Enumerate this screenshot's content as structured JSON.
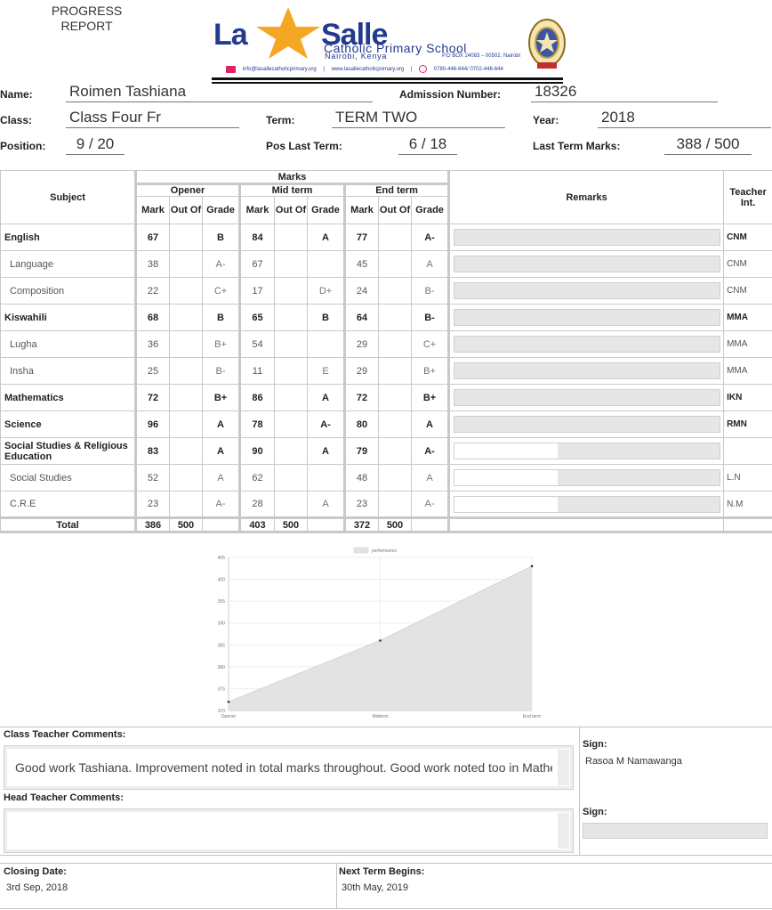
{
  "header": {
    "progress_line1": "PROGRESS",
    "progress_line2": "REPORT",
    "logo": {
      "word1": "La",
      "word2": "Salle",
      "school": "Catholic Primary School",
      "city": "Nairobi, Kenya",
      "po_box": "P.O BOX 24083 – 00502, Nairobi",
      "email": "info@lasallecatholicprimary.org",
      "website": "www.lasallecatholicprimary.org",
      "phone": "0780-446-644/ 0702-446-644",
      "colors": {
        "blue": "#233a8f",
        "star": "#f5a623"
      }
    }
  },
  "student": {
    "name_label": "Name:",
    "name": "Roimen Tashiana",
    "admission_label": "Admission Number:",
    "admission": "18326",
    "class_label": "Class:",
    "class": "Class Four Fr",
    "term_label": "Term:",
    "term": "TERM TWO",
    "year_label": "Year:",
    "year": "2018",
    "position_label": "Position:",
    "position": "9 / 20",
    "pos_last_label": "Pos Last Term:",
    "pos_last": "6 / 18",
    "last_marks_label": "Last Term Marks:",
    "last_marks": "388 / 500"
  },
  "table": {
    "headers": {
      "subject": "Subject",
      "marks": "Marks",
      "remarks": "Remarks",
      "teacher": "Teacher Int.",
      "opener": "Opener",
      "midterm": "Mid term",
      "endterm": "End term",
      "mark": "Mark",
      "outof": "Out Of",
      "grade": "Grade"
    },
    "rows": [
      {
        "name": "English",
        "level": "main",
        "op": [
          "67",
          "",
          "B"
        ],
        "mid": [
          "84",
          "",
          "A"
        ],
        "end": [
          "77",
          "",
          "A-"
        ],
        "remark": "",
        "remark_style": "full",
        "teacher": "CNM"
      },
      {
        "name": "Language",
        "level": "sub",
        "op": [
          "38",
          "",
          "A-"
        ],
        "mid": [
          "67",
          "",
          ""
        ],
        "end": [
          "45",
          "",
          "A"
        ],
        "remark": "",
        "remark_style": "full",
        "teacher": "CNM"
      },
      {
        "name": "Composition",
        "level": "sub",
        "op": [
          "22",
          "",
          "C+"
        ],
        "mid": [
          "17",
          "",
          "D+"
        ],
        "end": [
          "24",
          "",
          "B-"
        ],
        "remark": "",
        "remark_style": "full",
        "teacher": "CNM"
      },
      {
        "name": "Kiswahili",
        "level": "main",
        "op": [
          "68",
          "",
          "B"
        ],
        "mid": [
          "65",
          "",
          "B"
        ],
        "end": [
          "64",
          "",
          "B-"
        ],
        "remark": "",
        "remark_style": "full",
        "teacher": "MMA"
      },
      {
        "name": "Lugha",
        "level": "sub",
        "op": [
          "36",
          "",
          "B+"
        ],
        "mid": [
          "54",
          "",
          ""
        ],
        "end": [
          "29",
          "",
          "C+"
        ],
        "remark": "",
        "remark_style": "full",
        "teacher": "MMA"
      },
      {
        "name": "Insha",
        "level": "sub",
        "op": [
          "25",
          "",
          "B-"
        ],
        "mid": [
          "11",
          "",
          "E"
        ],
        "end": [
          "29",
          "",
          "B+"
        ],
        "remark": "",
        "remark_style": "full",
        "teacher": "MMA"
      },
      {
        "name": "Mathematics",
        "level": "main",
        "op": [
          "72",
          "",
          "B+"
        ],
        "mid": [
          "86",
          "",
          "A"
        ],
        "end": [
          "72",
          "",
          "B+"
        ],
        "remark": "",
        "remark_style": "full",
        "teacher": "IKN"
      },
      {
        "name": "Science",
        "level": "main",
        "op": [
          "96",
          "",
          "A"
        ],
        "mid": [
          "78",
          "",
          "A-"
        ],
        "end": [
          "80",
          "",
          "A"
        ],
        "remark": "",
        "remark_style": "full",
        "teacher": "RMN"
      },
      {
        "name": "Social Studies & Religious Education",
        "level": "main",
        "op": [
          "83",
          "",
          "A"
        ],
        "mid": [
          "90",
          "",
          "A"
        ],
        "end": [
          "79",
          "",
          "A-"
        ],
        "remark": "",
        "remark_style": "split",
        "teacher": ""
      },
      {
        "name": "Social Studies",
        "level": "sub",
        "op": [
          "52",
          "",
          "A"
        ],
        "mid": [
          "62",
          "",
          ""
        ],
        "end": [
          "48",
          "",
          "A"
        ],
        "remark": "",
        "remark_style": "split",
        "teacher": "L.N"
      },
      {
        "name": "C.R.E",
        "level": "sub",
        "op": [
          "23",
          "",
          "A-"
        ],
        "mid": [
          "28",
          "",
          "A"
        ],
        "end": [
          "23",
          "",
          "A-"
        ],
        "remark": "",
        "remark_style": "split",
        "teacher": "N.M"
      }
    ],
    "total": {
      "label": "Total",
      "op": [
        "386",
        "500",
        ""
      ],
      "mid": [
        "403",
        "500",
        ""
      ],
      "end": [
        "372",
        "500",
        ""
      ]
    }
  },
  "chart_data": {
    "type": "area",
    "title": "",
    "legend": [
      "performance"
    ],
    "legend_position": "top",
    "categories": [
      "Opener",
      "Midterm",
      "End term"
    ],
    "series": [
      {
        "name": "performance",
        "values": [
          372,
          386,
          403
        ]
      }
    ],
    "yticks": [
      370,
      375,
      380,
      385,
      390,
      395,
      400,
      405
    ],
    "ylim": [
      370,
      405
    ],
    "grid": true,
    "fill_color": "#e3e3e3",
    "line_color": "#d4d4d4"
  },
  "comments": {
    "class_teacher_label": "Class Teacher Comments:",
    "class_teacher_text": "Good work Tashiana. Improvement noted in total marks throughout. Good work noted too in Mathe",
    "sign_label": "Sign:",
    "class_teacher_sign": "Rasoa M Namawanga",
    "head_teacher_label": "Head Teacher Comments:",
    "head_teacher_text": "",
    "head_sign_label": "Sign:",
    "head_sign": ""
  },
  "footer": {
    "closing_label": "Closing Date:",
    "closing_date": "3rd Sep, 2018",
    "next_label": "Next Term Begins:",
    "next_date": "30th May, 2019"
  }
}
